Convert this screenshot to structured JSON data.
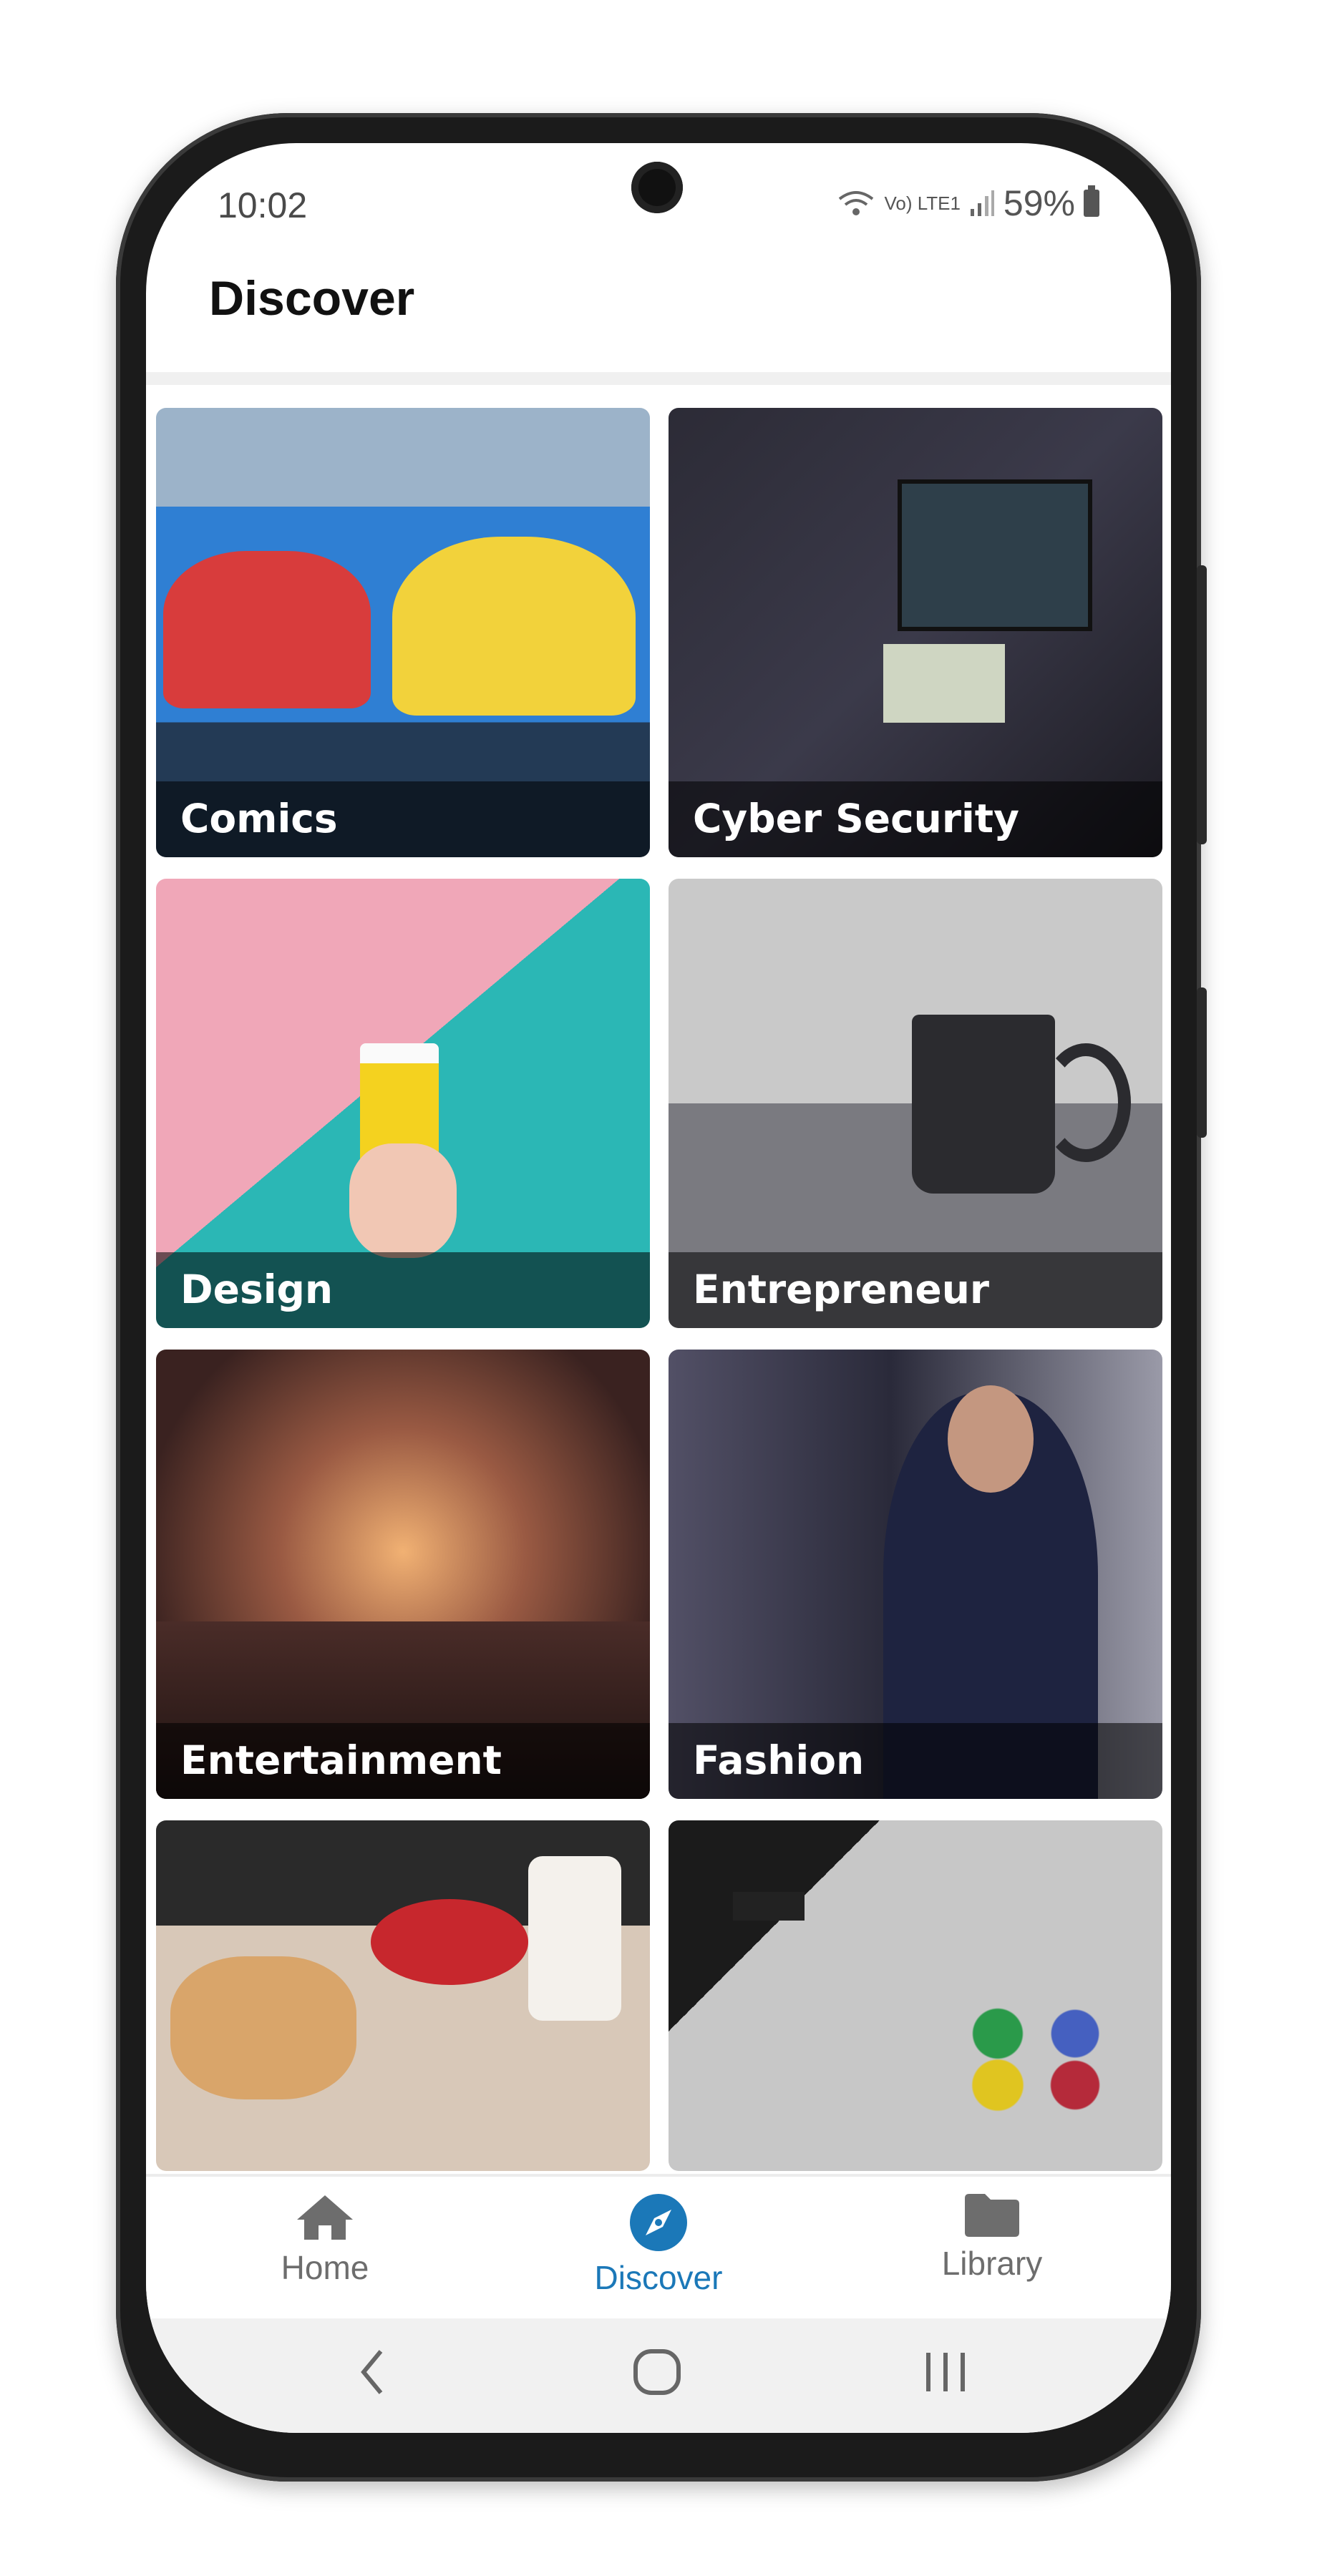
{
  "status": {
    "time": "10:02",
    "battery": "59%",
    "network": "Vo) LTE1"
  },
  "header": {
    "title": "Discover"
  },
  "categories": [
    {
      "label": "Comics"
    },
    {
      "label": "Cyber Security"
    },
    {
      "label": "Design"
    },
    {
      "label": "Entrepreneur"
    },
    {
      "label": "Entertainment"
    },
    {
      "label": "Fashion"
    }
  ],
  "bottom_nav": {
    "items": [
      {
        "label": "Home",
        "icon": "home-icon"
      },
      {
        "label": "Discover",
        "icon": "compass-icon",
        "active": true
      },
      {
        "label": "Library",
        "icon": "folder-icon"
      }
    ]
  },
  "colors": {
    "accent": "#1b78b8",
    "inactive": "#6d6d6d"
  }
}
